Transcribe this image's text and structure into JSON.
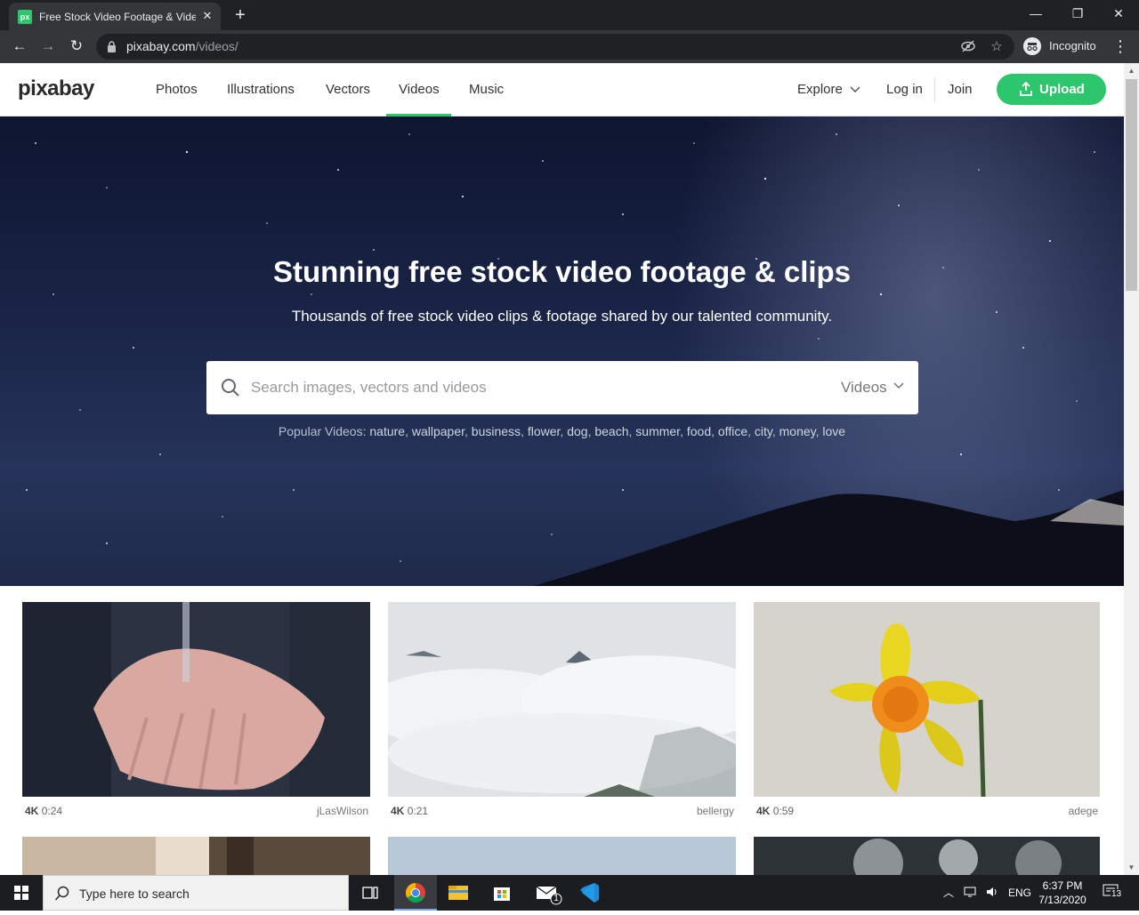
{
  "browser": {
    "tab_title": "Free Stock Video Footage & Videos",
    "favicon_text": "px",
    "url_host": "pixabay.com",
    "url_path": "/videos/",
    "profile_label": "Incognito"
  },
  "navbar": {
    "logo": "pixabay",
    "links": [
      "Photos",
      "Illustrations",
      "Vectors",
      "Videos",
      "Music"
    ],
    "active": "Videos",
    "explore": "Explore",
    "login": "Log in",
    "join": "Join",
    "upload": "Upload",
    "accent_color": "#2ec66d"
  },
  "hero": {
    "title": "Stunning free stock video footage & clips",
    "subtitle": "Thousands of free stock video clips & footage shared by our talented community.",
    "search_placeholder": "Search images, vectors and videos",
    "search_type": "Videos",
    "popular_label": "Popular Videos:",
    "popular_terms": [
      "nature",
      "wallpaper",
      "business",
      "flower",
      "dog",
      "beach",
      "summer",
      "food",
      "office",
      "city",
      "money",
      "love"
    ]
  },
  "videos": [
    {
      "quality": "4K",
      "duration": "0:24",
      "author": "jLasWilson",
      "subject": "hands-water"
    },
    {
      "quality": "4K",
      "duration": "0:21",
      "author": "bellergy",
      "subject": "clouds-mountains"
    },
    {
      "quality": "4K",
      "duration": "0:59",
      "author": "adege",
      "subject": "daffodil"
    }
  ],
  "taskbar": {
    "search_text": "Type here to search",
    "language": "ENG",
    "time": "6:37 PM",
    "date": "7/13/2020",
    "notifications": "13",
    "mail_badge": "1"
  }
}
